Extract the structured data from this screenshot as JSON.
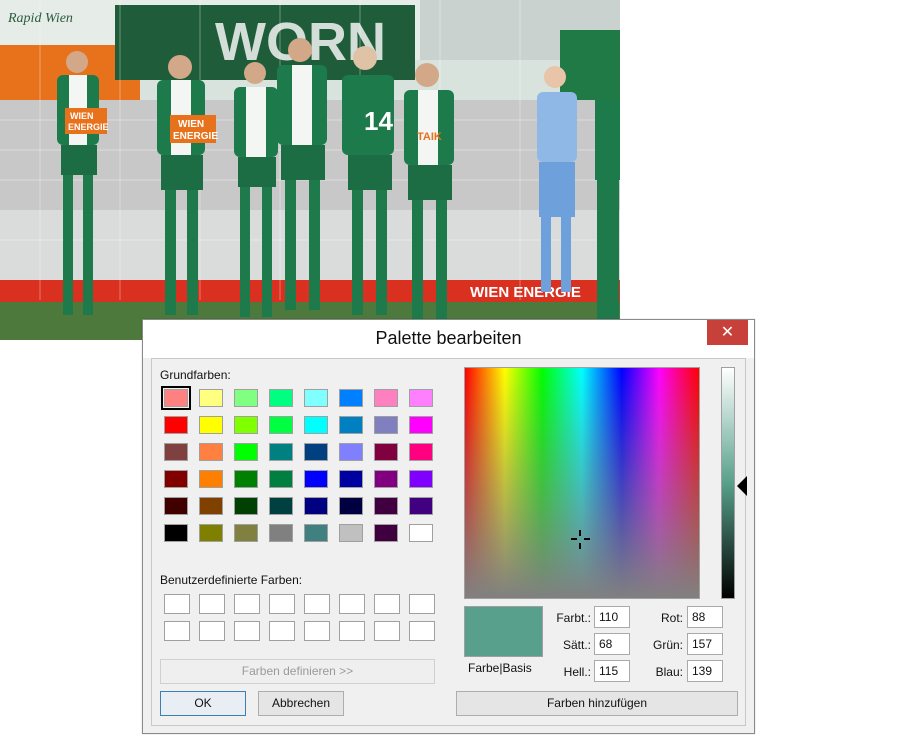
{
  "photo": {
    "banner_text": "Rapid Wien",
    "stand_text": "WORN",
    "jersey_sponsor_lines": [
      "WIEN",
      "ENERGIE"
    ],
    "jersey_number": "14",
    "sponsor_alt": "TAIK",
    "ad_board_text": "WIEN ENERGIE"
  },
  "dialog": {
    "title": "Palette bearbeiten",
    "close_glyph": "✕",
    "basic_colors_label": "Grundfarben:",
    "custom_colors_label": "Benutzerdefinierte Farben:",
    "define_button": "Farben definieren >>",
    "ok_button": "OK",
    "cancel_button": "Abbrechen",
    "preview_label": "Farbe|Basis",
    "add_button": "Farben hinzufügen",
    "fields": {
      "hue_label": "Farbt.:",
      "hue": "110",
      "sat_label": "Sätt.:",
      "sat": "68",
      "lum_label": "Hell.:",
      "lum": "115",
      "red_label": "Rot:",
      "red": "88",
      "green_label": "Grün:",
      "green": "157",
      "blue_label": "Blau:",
      "blue": "139"
    },
    "current_color": "#58a08b",
    "basic_colors": [
      [
        "#ff8080",
        "#ffff80",
        "#80ff80",
        "#00ff80",
        "#80ffff",
        "#0080ff",
        "#ff80c0",
        "#ff80ff"
      ],
      [
        "#ff0000",
        "#ffff00",
        "#80ff00",
        "#00ff40",
        "#00ffff",
        "#0080c0",
        "#8080c0",
        "#ff00ff"
      ],
      [
        "#804040",
        "#ff8040",
        "#00ff00",
        "#008080",
        "#004080",
        "#8080ff",
        "#800040",
        "#ff0080"
      ],
      [
        "#800000",
        "#ff8000",
        "#008000",
        "#008040",
        "#0000ff",
        "#0000a0",
        "#800080",
        "#8000ff"
      ],
      [
        "#400000",
        "#804000",
        "#004000",
        "#004040",
        "#000080",
        "#000040",
        "#400040",
        "#400080"
      ],
      [
        "#000000",
        "#808000",
        "#808040",
        "#808080",
        "#408080",
        "#c0c0c0",
        "#400040",
        "#ffffff"
      ]
    ]
  }
}
